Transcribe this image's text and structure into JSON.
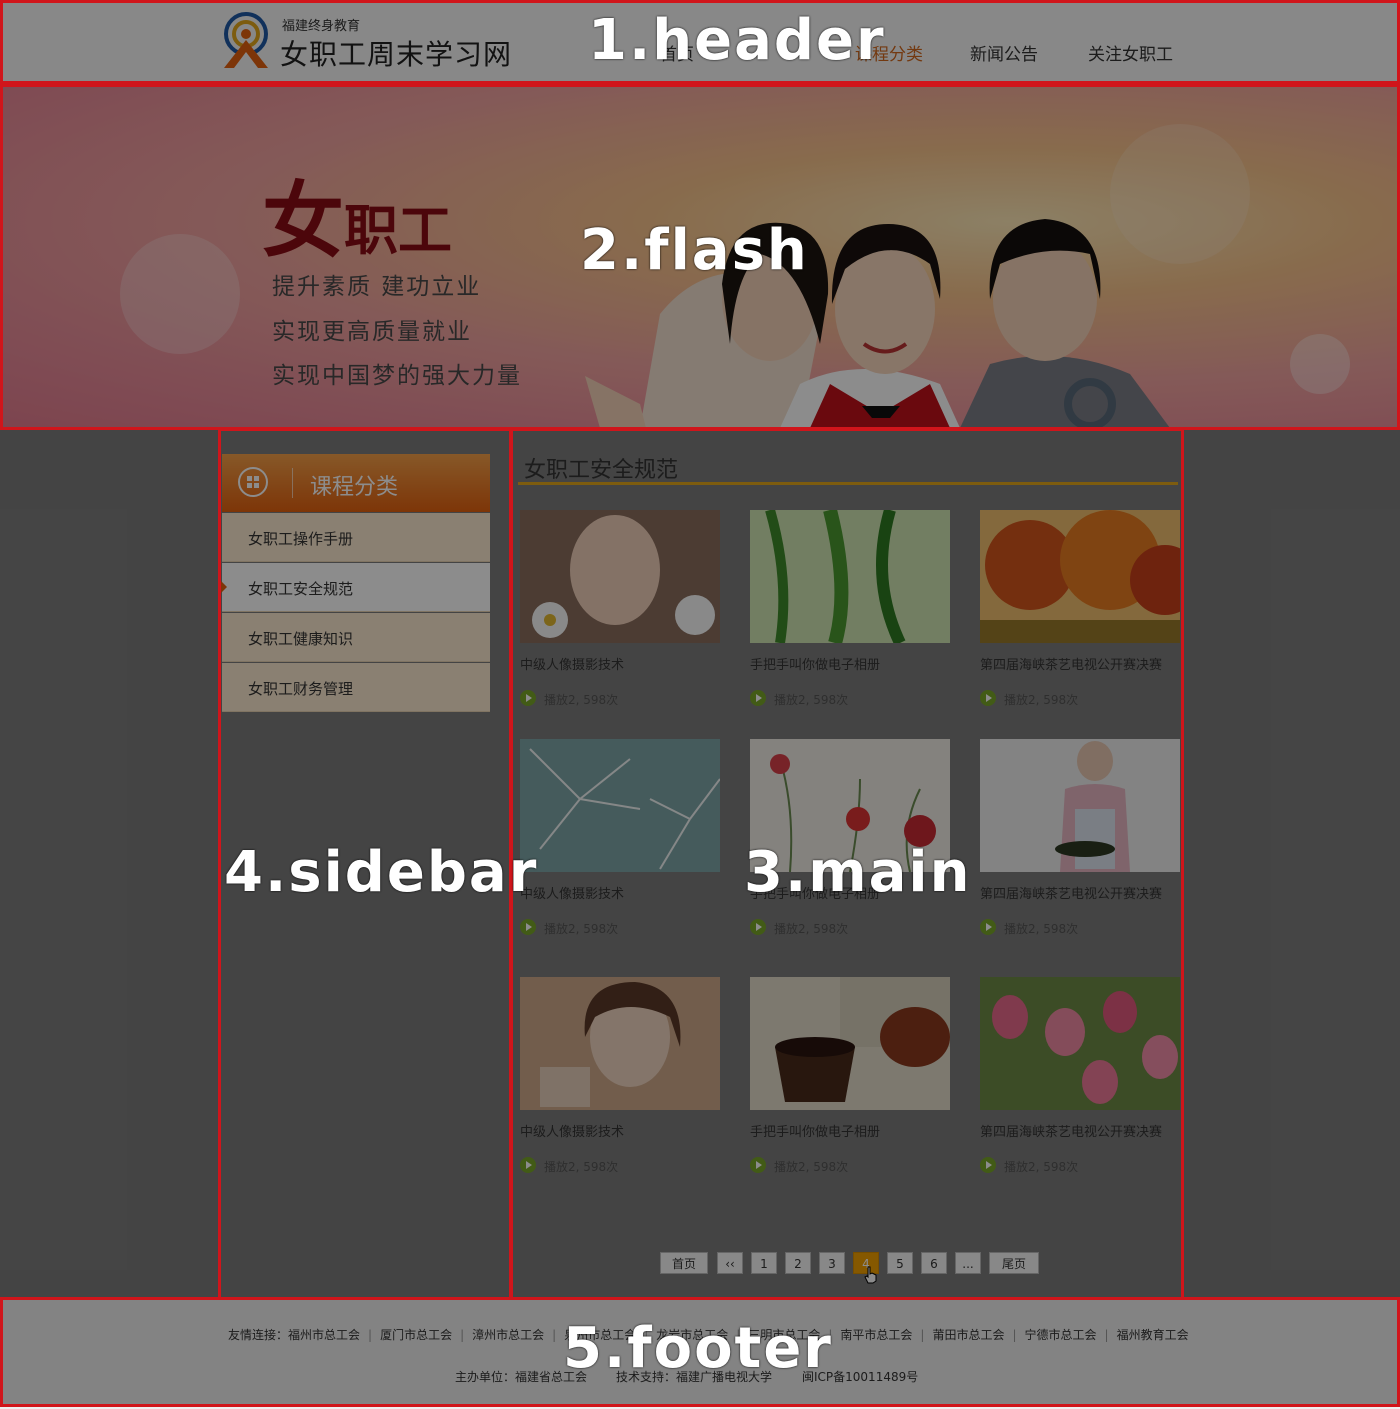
{
  "header": {
    "brand_small": "福建终身教育",
    "brand_big": "女职工周末学习网",
    "nav": [
      {
        "label": "首页"
      },
      {
        "label": "课程分类"
      },
      {
        "label": "新闻公告"
      },
      {
        "label": "关注女职工"
      }
    ]
  },
  "flash": {
    "title_big": "女",
    "title_rest": "职工",
    "slogans": [
      "提升素质 建功立业",
      "实现更高质量就业",
      "实现中国梦的强大力量"
    ]
  },
  "sidebar": {
    "title": "课程分类",
    "items": [
      {
        "label": "女职工操作手册"
      },
      {
        "label": "女职工安全规范"
      },
      {
        "label": "女职工健康知识"
      },
      {
        "label": "女职工财务管理"
      }
    ]
  },
  "main": {
    "title": "女职工安全规范",
    "videos": [
      {
        "title": "中级人像摄影技术",
        "plays": "播放2, 598次",
        "thumb": "portrait-girl-flowers"
      },
      {
        "title": "手把手叫你做电子相册",
        "plays": "播放2, 598次",
        "thumb": "green-willow"
      },
      {
        "title": "第四届海峡茶艺电视公开赛决赛",
        "plays": "播放2, 598次",
        "thumb": "autumn-trees"
      },
      {
        "title": "中级人像摄影技术",
        "plays": "播放2, 598次",
        "thumb": "dandelion"
      },
      {
        "title": "手把手叫你做电子相册",
        "plays": "播放2, 598次",
        "thumb": "red-poppies"
      },
      {
        "title": "第四届海峡茶艺电视公开赛决赛",
        "plays": "播放2, 598次",
        "thumb": "elderly-woman-cooking"
      },
      {
        "title": "中级人像摄影技术",
        "plays": "播放2, 598次",
        "thumb": "portrait-young-woman"
      },
      {
        "title": "手把手叫你做电子相册",
        "plays": "播放2, 598次",
        "thumb": "coffee-cup"
      },
      {
        "title": "第四届海峡茶艺电视公开赛决赛",
        "plays": "播放2, 598次",
        "thumb": "pink-bell-flowers"
      }
    ],
    "pagination": {
      "first": "首页",
      "prev": "‹‹",
      "pages": [
        "1",
        "2",
        "3",
        "4",
        "5",
        "6"
      ],
      "current": "4",
      "ellipsis": "...",
      "last": "尾页"
    }
  },
  "footer": {
    "links_label": "友情连接：",
    "links": [
      "福州市总工会",
      "厦门市总工会",
      "漳州市总工会",
      "泉州市总工会",
      "龙岩市总工会",
      "三明市总工会",
      "南平市总工会",
      "莆田市总工会",
      "宁德市总工会",
      "福州教育工会"
    ],
    "sponsor": "主办单位：福建省总工会",
    "tech": "技术支持：福建广播电视大学",
    "icp": "闽ICP备10011489号"
  },
  "annotations": [
    {
      "label": "1.header"
    },
    {
      "label": "2.flash"
    },
    {
      "label": "3.main"
    },
    {
      "label": "4.sidebar"
    },
    {
      "label": "5.footer"
    }
  ],
  "colors": {
    "accent_orange": "#e4620f",
    "annotation_red": "#d0151b",
    "play_green": "#78a629",
    "title_underline": "#e4a81c"
  }
}
